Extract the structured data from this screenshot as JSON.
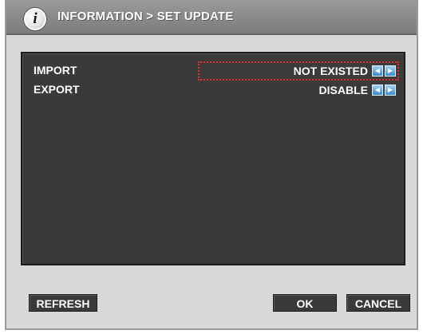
{
  "header": {
    "title": "INFORMATION > SET UPDATE",
    "icon": "info-icon",
    "icon_glyph": "i"
  },
  "settings": [
    {
      "label": "IMPORT",
      "value": "NOT EXISTED",
      "selected": true,
      "prev_glyph": "◀",
      "next_glyph": "▶"
    },
    {
      "label": "EXPORT",
      "value": "DISABLE",
      "selected": false,
      "prev_glyph": "◀",
      "next_glyph": "▶"
    }
  ],
  "buttons": {
    "refresh": "REFRESH",
    "ok": "OK",
    "cancel": "CANCEL"
  },
  "colors": {
    "panel_background": "#3a3a3a",
    "dialog_background": "#d8d8d8",
    "title_bar": "#8a8a8a",
    "selection_outline": "#e23030",
    "arrow_button": "#3c8ccc",
    "text": "#ffffff"
  }
}
